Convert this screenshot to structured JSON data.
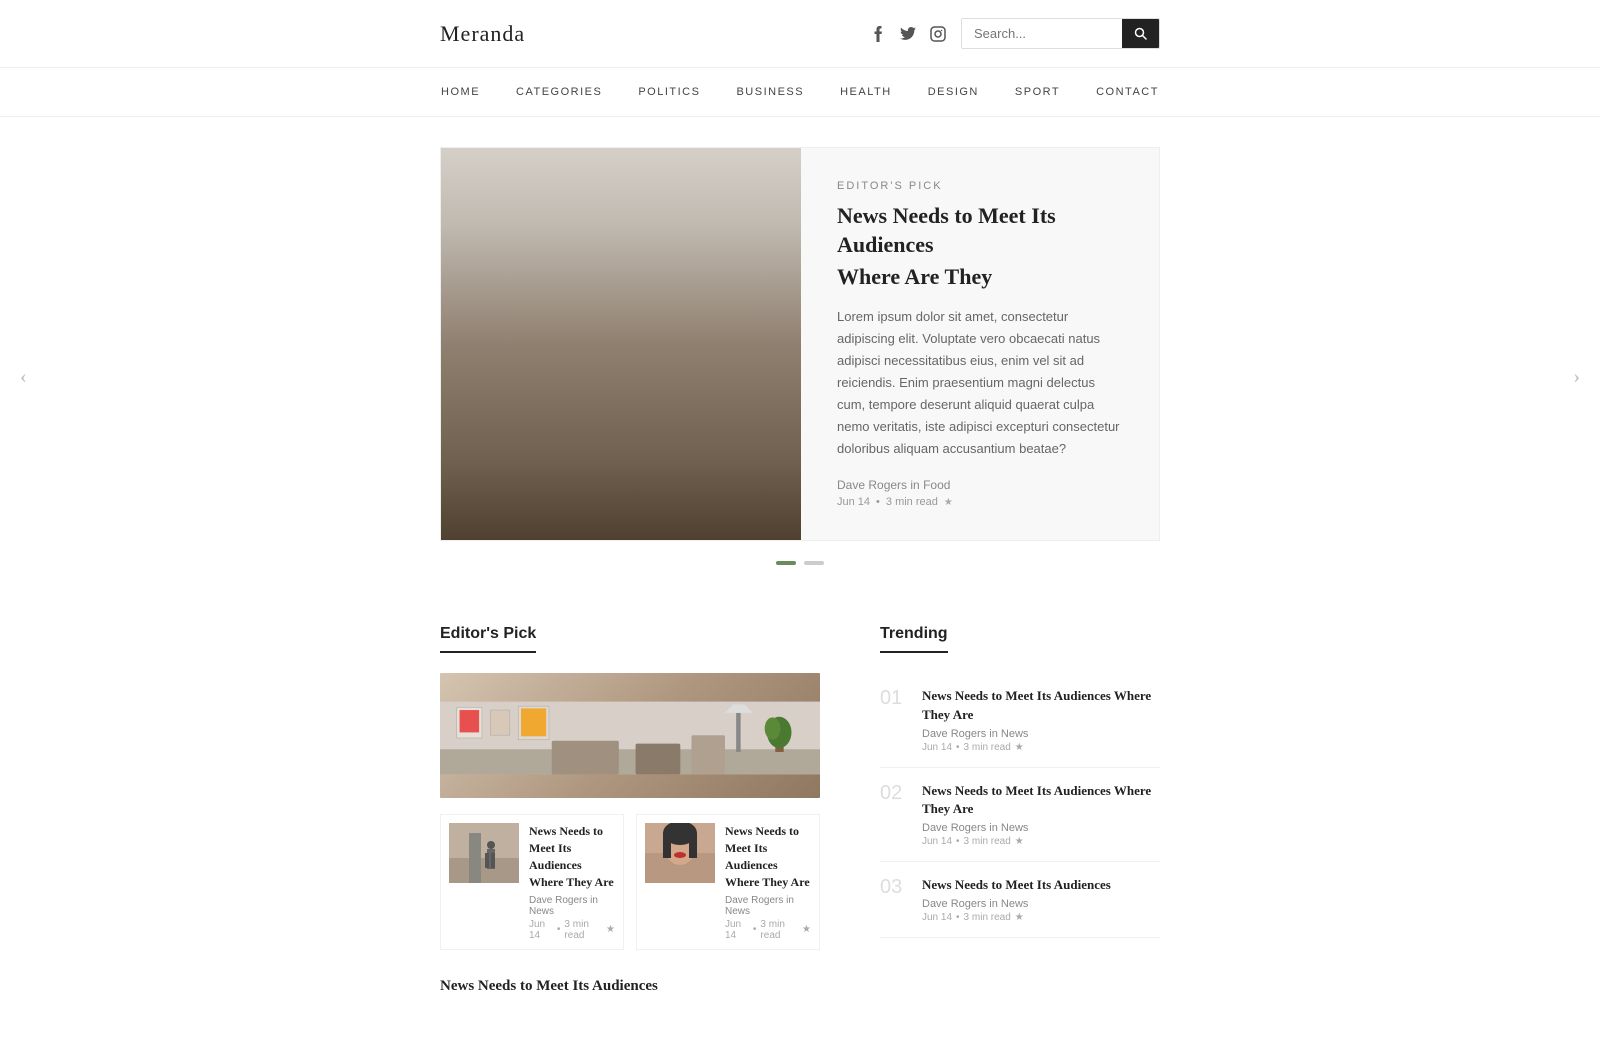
{
  "header": {
    "logo": "Meranda",
    "search_placeholder": "Search...",
    "search_btn_icon": "🔍",
    "social": [
      {
        "icon": "f",
        "name": "facebook"
      },
      {
        "icon": "t",
        "name": "twitter"
      },
      {
        "icon": "◎",
        "name": "instagram"
      }
    ]
  },
  "nav": {
    "items": [
      {
        "label": "HOME"
      },
      {
        "label": "CATEGORIES"
      },
      {
        "label": "POLITICS"
      },
      {
        "label": "BUSINESS"
      },
      {
        "label": "HEALTH"
      },
      {
        "label": "DESIGN"
      },
      {
        "label": "SPORT"
      },
      {
        "label": "CONTACT"
      }
    ]
  },
  "featured": {
    "editors_pick_label": "EDITOR'S PICK",
    "title_line1": "News Needs to Meet Its Audiences",
    "title_line2": "Where Are They",
    "description": "Lorem ipsum dolor sit amet, consectetur adipiscing elit. Voluptate vero obcaecati natus adipisci necessitatibus eius, enim vel sit ad reiciendis. Enim praesentium magni delectus cum, tempore deserunt aliquid quaerat culpa nemo veritatis, iste adipisci excepturi consectetur doloribus aliquam accusantium beatae?",
    "author": "Dave Rogers",
    "category": "Food",
    "date": "Jun 14",
    "read_time": "3 min read"
  },
  "carousel_dots": {
    "active": 0,
    "total": 2
  },
  "editors_pick": {
    "section_title": "Editor's Pick",
    "small_cards": [
      {
        "title": "News Needs to Meet Its Audiences Where They Are",
        "author": "Dave Rogers",
        "author_in": "in",
        "category": "News",
        "date": "Jun 14",
        "read_time": "3 min read"
      },
      {
        "title": "News Needs to Meet Its Audiences Where They Are",
        "author": "Dave Rogers",
        "author_in": "in",
        "category": "News",
        "date": "Jun 14",
        "read_time": "3 min read"
      }
    ],
    "bottom_title": "News Needs to Meet Its Audiences"
  },
  "trending": {
    "section_title": "Trending",
    "items": [
      {
        "number": "01",
        "title": "News Needs to Meet Its Audiences Where They Are",
        "author": "Dave Rogers",
        "category": "News",
        "date": "Jun 14",
        "read_time": "3 min read"
      },
      {
        "number": "02",
        "title": "News Needs to Meet Its Audiences Where They Are",
        "author": "Dave Rogers",
        "category": "News",
        "date": "Jun 14",
        "read_time": "3 min read"
      },
      {
        "number": "03",
        "title": "News Needs to Meet Its Audiences",
        "author": "Dave Rogers",
        "category": "News",
        "date": "Jun 14",
        "read_time": "3 min read"
      }
    ]
  },
  "arrows": {
    "left": "‹",
    "right": "›"
  }
}
